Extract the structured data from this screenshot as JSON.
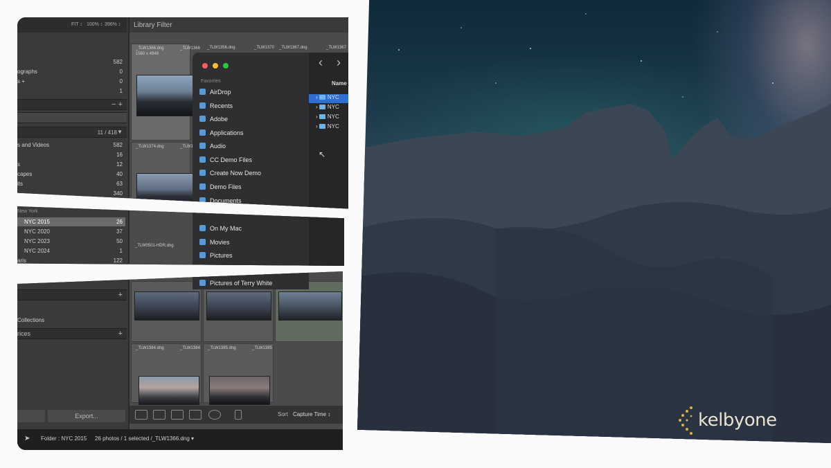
{
  "library": {
    "filter_title": "Library Filter",
    "zoom_fit": "FIT ↕",
    "zoom_100": "100% ↕",
    "zoom_other": "396% ↕",
    "catalog": [
      {
        "label": "",
        "count": "582"
      },
      {
        "label": "ographs",
        "count": "0"
      },
      {
        "label": "s +",
        "count": "0"
      },
      {
        "label": "",
        "count": "1"
      }
    ],
    "folders_count": "11 / 418",
    "folders": [
      {
        "label": "s and Videos",
        "count": "582"
      },
      {
        "label": "",
        "count": "16"
      },
      {
        "label": "s",
        "count": "12"
      },
      {
        "label": "capes",
        "count": "40"
      },
      {
        "label": "its",
        "count": "63"
      },
      {
        "label": "",
        "count": "340"
      }
    ],
    "nyc_group": "New York",
    "nyc_folders": [
      {
        "label": "NYC 2015",
        "count": "26"
      },
      {
        "label": "NYC 2020",
        "count": "37"
      },
      {
        "label": "NYC 2023",
        "count": "50"
      },
      {
        "label": "NYC 2024",
        "count": "1"
      },
      {
        "label": "aris",
        "count": "122"
      }
    ],
    "collections_label": "Collections",
    "services_label": "rices",
    "export_label": "Export...",
    "sort_label": "Sort",
    "sort_value": "Capture Time ↕",
    "status_folder": "Folder : NYC 2015",
    "status_count": "26 photos / 1 selected /_TLW1366.dng ▾",
    "files_top": [
      "_TLW1366.dng",
      "_TLW1366",
      "_TLW1356.dng",
      "_TLW1370",
      "_TLW1367.dng",
      "_TLW1367"
    ],
    "files_mid": [
      "_TLW1374.dng",
      "_TLW1"
    ],
    "files_mid2": [
      "_TLW0501-HDR.dng"
    ],
    "files_bottom": [
      "_TLW1384.dng",
      "_TLW1384",
      "_TLW1385.dng",
      "_TLW1385"
    ],
    "dims": "1560 x 4948"
  },
  "finder": {
    "section_favorites": "Favorites",
    "items": [
      "AirDrop",
      "Recents",
      "Adobe",
      "Applications",
      "Audio",
      "CC Demo Files",
      "Create Now Demo",
      "Demo Files",
      "Documents"
    ],
    "items_lower": [
      "On My Mac",
      "Movies",
      "Pictures"
    ],
    "items_bottom": [
      "Pictures of Terry White"
    ],
    "column_header": "Name",
    "folders": [
      "NYC",
      "NYC",
      "NYC",
      "NYC"
    ],
    "back": "‹",
    "forward": "›"
  },
  "brand": {
    "text": "kelbyone"
  },
  "colors": {
    "accent": "#3b82d6",
    "brand_gold": "#d9b24a"
  }
}
